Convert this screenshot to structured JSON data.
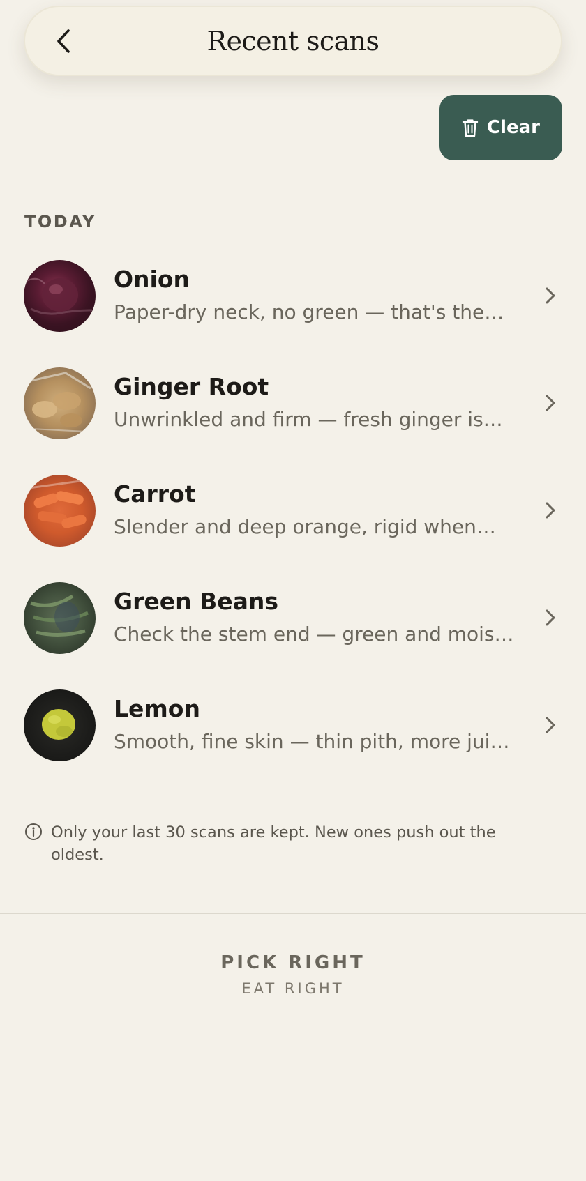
{
  "header": {
    "title": "Recent scans",
    "back_icon": "chevron-left-icon"
  },
  "clear_button": {
    "label": "Clear",
    "icon": "trash-icon",
    "color": "#3a5c52"
  },
  "section": {
    "label": "TODAY"
  },
  "scans": [
    {
      "name": "Onion",
      "description": "Paper-dry neck, no green — that's the…",
      "thumbnail": "red onion photo"
    },
    {
      "name": "Ginger Root",
      "description": "Unwrinkled and firm — fresh ginger is…",
      "thumbnail": "ginger root photo"
    },
    {
      "name": "Carrot",
      "description": "Slender and deep orange, rigid when…",
      "thumbnail": "bagged carrots photo"
    },
    {
      "name": "Green Beans",
      "description": "Check the stem end — green and mois…",
      "thumbnail": "green beans photo"
    },
    {
      "name": "Lemon",
      "description": "Smooth, fine skin — thin pith, more jui…",
      "thumbnail": "lemon photo"
    }
  ],
  "info": {
    "icon": "info-icon",
    "text": "Only your last 30 scans are kept. New ones push out the oldest."
  },
  "brand": {
    "line1": "PICK RIGHT",
    "line2": "EAT RIGHT"
  },
  "colors": {
    "background": "#f4f1e9",
    "accent": "#3a5c52",
    "text_primary": "#1d1b18",
    "text_secondary": "#6a665c"
  }
}
